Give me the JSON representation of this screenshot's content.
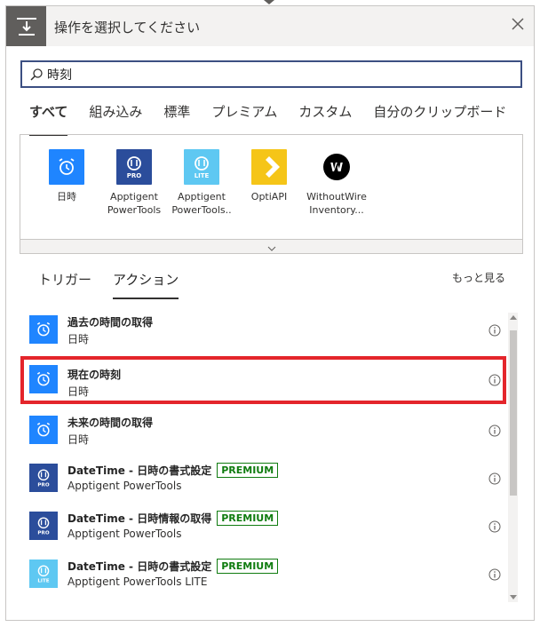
{
  "header": {
    "title": "操作を選択してください"
  },
  "search": {
    "value": "時刻",
    "placeholder": ""
  },
  "tabs": [
    {
      "label": "すべて",
      "active": true
    },
    {
      "label": "組み込み"
    },
    {
      "label": "標準"
    },
    {
      "label": "プレミアム"
    },
    {
      "label": "カスタム"
    },
    {
      "label": "自分のクリップボード"
    }
  ],
  "connectors": [
    {
      "name": "日時",
      "icon": "alarm-clock-icon",
      "color": "#1f85ff"
    },
    {
      "name": "Apptigent PowerTools",
      "icon": "apptigent-pro-icon",
      "color": "#2b4d9b"
    },
    {
      "name": "Apptigent PowerTools..",
      "icon": "apptigent-lite-icon",
      "color": "#5ec8f2"
    },
    {
      "name": "OptiAPI",
      "icon": "optiapi-icon",
      "color": "#f5c518"
    },
    {
      "name": "WithoutWire Inventory...",
      "icon": "withoutwire-icon",
      "color": "#000000"
    }
  ],
  "sub_tabs": [
    {
      "label": "トリガー"
    },
    {
      "label": "アクション",
      "active": true
    }
  ],
  "more_label": "もっと見る",
  "actions": [
    {
      "title": "過去の時間の取得",
      "subtitle": "日時",
      "premium": ""
    },
    {
      "title": "現在の時刻",
      "subtitle": "日時",
      "premium": "",
      "highlight": true
    },
    {
      "title": "未来の時間の取得",
      "subtitle": "日時",
      "premium": ""
    },
    {
      "title": "DateTime - 日時の書式設定",
      "subtitle": "Apptigent PowerTools",
      "premium": "PREMIUM"
    },
    {
      "title": "DateTime - 日時情報の取得",
      "subtitle": "Apptigent PowerTools",
      "premium": "PREMIUM"
    },
    {
      "title": "DateTime - 日時の書式設定",
      "subtitle": "Apptigent PowerTools LITE",
      "premium": "PREMIUM"
    }
  ],
  "colors": {
    "accent": "#3c4f82",
    "highlight": "#e4252b",
    "premium": "#107c10"
  }
}
